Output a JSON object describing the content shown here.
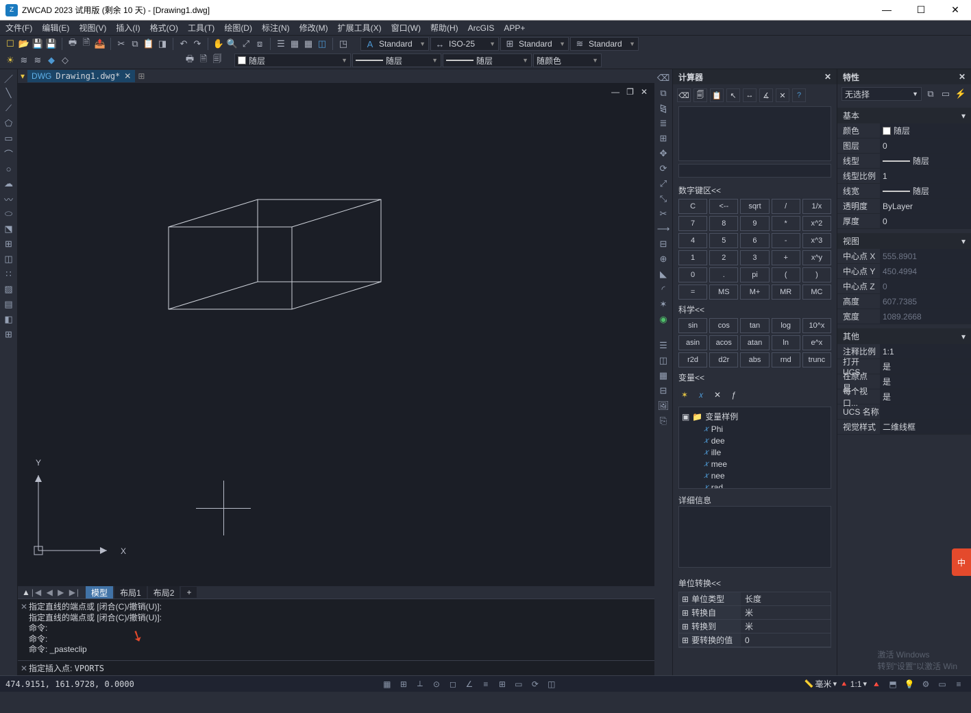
{
  "title": "ZWCAD 2023 试用版 (剩余 10 天) - [Drawing1.dwg]",
  "menu": [
    "文件(F)",
    "编辑(E)",
    "视图(V)",
    "插入(I)",
    "格式(O)",
    "工具(T)",
    "绘图(D)",
    "标注(N)",
    "修改(M)",
    "扩展工具(X)",
    "窗口(W)",
    "帮助(H)",
    "ArcGIS",
    "APP+"
  ],
  "toolbar_styles": {
    "text_style_icon": "A",
    "text_style": "Standard",
    "dim_style_icon": "↔",
    "dim_style": "ISO-25",
    "table_style_icon": "⊞",
    "table_style": "Standard",
    "ml_style_icon": "≋",
    "ml_style": "Standard"
  },
  "toolbar_layer": {
    "layer_icon": "☀",
    "layer": "随层",
    "ltype": "随层",
    "lweight": "随层",
    "color": "随颜色"
  },
  "dwgtab": {
    "name": "Drawing1.dwg*"
  },
  "layout_tabs": {
    "model": "模型",
    "b1": "布局1",
    "b2": "布局2"
  },
  "cmd": {
    "history": [
      "指定直线的端点或 [闭合(C)/撤销(U)]:",
      "指定直线的端点或 [闭合(C)/撤销(U)]:",
      "命令:",
      "命令:",
      "命令: _pasteclip"
    ],
    "prompt": "指定插入点:",
    "input": "VPORTS"
  },
  "calc": {
    "title": "计算器",
    "numpad_label": "数字键区<<",
    "numpad": [
      [
        "C",
        "<--",
        "sqrt",
        "/",
        "1/x"
      ],
      [
        "7",
        "8",
        "9",
        "*",
        "x^2"
      ],
      [
        "4",
        "5",
        "6",
        "-",
        "x^3"
      ],
      [
        "1",
        "2",
        "3",
        "+",
        "x^y"
      ],
      [
        "0",
        ".",
        "pi",
        "(",
        ")"
      ],
      [
        "=",
        "MS",
        "M+",
        "MR",
        "MC"
      ]
    ],
    "sci_label": "科学<<",
    "sci": [
      [
        "sin",
        "cos",
        "tan",
        "log",
        "10^x"
      ],
      [
        "asin",
        "acos",
        "atan",
        "ln",
        "e^x"
      ],
      [
        "r2d",
        "d2r",
        "abs",
        "rnd",
        "trunc"
      ]
    ],
    "var_label": "变量<<",
    "var_tree_root": "变量样例",
    "var_tree": [
      "Phi",
      "dee",
      "ille",
      "mee",
      "nee",
      "rad"
    ],
    "detail_label": "详细信息",
    "unit_label": "单位转换<<",
    "unit_rows": [
      {
        "l": "单位类型",
        "v": "长度"
      },
      {
        "l": "转换自",
        "v": "米"
      },
      {
        "l": "转换到",
        "v": "米"
      },
      {
        "l": "要转换的值",
        "v": "0"
      }
    ]
  },
  "props": {
    "title": "特性",
    "selection": "无选择",
    "groups": {
      "basic": {
        "label": "基本",
        "rows": [
          {
            "l": "颜色",
            "v": "随层",
            "swatch": "#fff"
          },
          {
            "l": "图层",
            "v": "0"
          },
          {
            "l": "线型",
            "v": "随层",
            "line": true
          },
          {
            "l": "线型比例",
            "v": "1"
          },
          {
            "l": "线宽",
            "v": "随层",
            "line": true
          },
          {
            "l": "透明度",
            "v": "ByLayer"
          },
          {
            "l": "厚度",
            "v": "0"
          }
        ]
      },
      "view": {
        "label": "视图",
        "rows": [
          {
            "l": "中心点 X",
            "v": "555.8901",
            "dim": true
          },
          {
            "l": "中心点 Y",
            "v": "450.4994",
            "dim": true
          },
          {
            "l": "中心点 Z",
            "v": "0",
            "dim": true
          },
          {
            "l": "高度",
            "v": "607.7385",
            "dim": true
          },
          {
            "l": "宽度",
            "v": "1089.2668",
            "dim": true
          }
        ]
      },
      "other": {
        "label": "其他",
        "rows": [
          {
            "l": "注释比例",
            "v": "1:1"
          },
          {
            "l": "打开 UCS...",
            "v": "是"
          },
          {
            "l": "在原点显...",
            "v": "是"
          },
          {
            "l": "每个视口...",
            "v": "是"
          },
          {
            "l": "UCS 名称",
            "v": ""
          },
          {
            "l": "视觉样式",
            "v": "二维线框"
          }
        ]
      }
    }
  },
  "status": {
    "coords": "474.9151, 161.9728, 0.0000",
    "units": "毫米",
    "scale": "1:1"
  },
  "watermark": {
    "l1": "激活 Windows",
    "l2": "转到\"设置\"以激活 Win"
  },
  "ime": "中"
}
